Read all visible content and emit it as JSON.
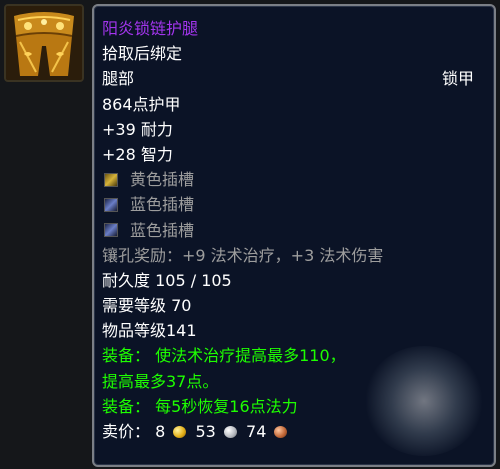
{
  "item": {
    "name": "阳炎锁链护腿",
    "binding": "拾取后绑定",
    "slot": "腿部",
    "armor_type": "锁甲",
    "armor": "864点护甲",
    "stats": [
      "+39 耐力",
      "+28 智力"
    ],
    "sockets": [
      {
        "color": "yellow",
        "label": "黄色插槽"
      },
      {
        "color": "blue",
        "label": "蓝色插槽"
      },
      {
        "color": "blue",
        "label": "蓝色插槽"
      }
    ],
    "socket_bonus": "镶孔奖励：+9 法术治疗，+3 法术伤害",
    "durability": "耐久度 105 / 105",
    "required_level": "需要等级 70",
    "item_level": "物品等级141",
    "equip_effects": [
      "装备： 使法术治疗提高最多110，",
      "提高最多37点。",
      "装备： 每5秒恢复16点法力"
    ],
    "sell_price": {
      "label": "卖价：",
      "gold": "8",
      "silver": "53",
      "copper": "74"
    }
  },
  "colors": {
    "item_name": "#a335ee",
    "equip_text": "#1eff00",
    "socket_text": "#9d9d9d",
    "tooltip_bg": "#0b1326",
    "border": "#7b7f86"
  },
  "icons": {
    "item_icon": "chain-leggings-icon",
    "socket_yellow": "yellow-socket-icon",
    "socket_blue": "blue-socket-icon",
    "gold": "gold-coin-icon",
    "silver": "silver-coin-icon",
    "copper": "copper-coin-icon"
  }
}
